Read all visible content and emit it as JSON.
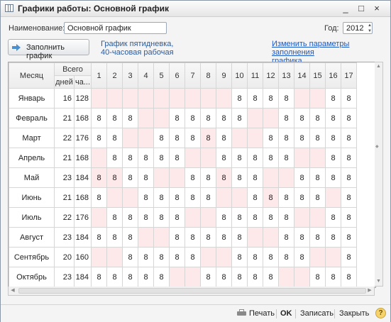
{
  "window": {
    "title": "Графики работы: Основной график",
    "buttons": [
      "_",
      "□",
      "×"
    ]
  },
  "form": {
    "name_label": "Наименование:",
    "name_value": "Основной график",
    "year_label": "Год:",
    "year_value": "2012",
    "fill_button": "Заполнить график",
    "info_line1": "График пятидневка,",
    "info_line2": "40-часовая рабочая",
    "link_line1": "Изменить параметры заполнения",
    "link_line2": "графика..."
  },
  "table": {
    "header_month": "Месяц",
    "header_total": "Всего",
    "header_days": "дней",
    "header_hours": "ча...",
    "day_columns": [
      "1",
      "2",
      "3",
      "4",
      "5",
      "6",
      "7",
      "8",
      "9",
      "10",
      "11",
      "12",
      "13",
      "14",
      "15",
      "16",
      "17"
    ],
    "rows": [
      {
        "month": "Январь",
        "days": "16",
        "hours": "128",
        "cells": [
          "",
          "",
          "",
          "",
          "",
          "",
          "",
          "",
          "",
          "8",
          "8",
          "8",
          "8",
          "",
          "",
          "8",
          "8"
        ],
        "we": [
          1,
          1,
          1,
          1,
          1,
          1,
          1,
          1,
          1,
          0,
          0,
          0,
          0,
          1,
          1,
          0,
          0
        ]
      },
      {
        "month": "Февраль",
        "days": "21",
        "hours": "168",
        "cells": [
          "8",
          "8",
          "8",
          "",
          "",
          "8",
          "8",
          "8",
          "8",
          "8",
          "",
          "",
          "8",
          "8",
          "8",
          "8",
          "8"
        ],
        "we": [
          0,
          0,
          0,
          1,
          1,
          0,
          0,
          0,
          0,
          0,
          1,
          1,
          0,
          0,
          0,
          0,
          0
        ]
      },
      {
        "month": "Март",
        "days": "22",
        "hours": "176",
        "cells": [
          "8",
          "8",
          "",
          "",
          "8",
          "8",
          "8",
          "8",
          "8",
          "",
          "",
          "8",
          "8",
          "8",
          "8",
          "8",
          "8"
        ],
        "we": [
          0,
          0,
          1,
          1,
          0,
          0,
          0,
          1,
          0,
          1,
          1,
          0,
          0,
          0,
          0,
          0,
          0
        ]
      },
      {
        "month": "Апрель",
        "days": "21",
        "hours": "168",
        "cells": [
          "",
          "8",
          "8",
          "8",
          "8",
          "8",
          "",
          "",
          "8",
          "8",
          "8",
          "8",
          "8",
          "",
          "",
          "8",
          "8"
        ],
        "we": [
          1,
          0,
          0,
          0,
          0,
          0,
          1,
          1,
          0,
          0,
          0,
          0,
          0,
          1,
          1,
          0,
          0
        ]
      },
      {
        "month": "Май",
        "days": "23",
        "hours": "184",
        "cells": [
          "8",
          "8",
          "8",
          "8",
          "",
          "",
          "8",
          "8",
          "8",
          "8",
          "8",
          "",
          "",
          "8",
          "8",
          "8",
          "8"
        ],
        "we": [
          1,
          1,
          0,
          0,
          1,
          1,
          0,
          0,
          1,
          0,
          0,
          1,
          1,
          0,
          0,
          0,
          0
        ]
      },
      {
        "month": "Июнь",
        "days": "21",
        "hours": "168",
        "cells": [
          "8",
          "",
          "",
          "8",
          "8",
          "8",
          "8",
          "8",
          "",
          "",
          "8",
          "8",
          "8",
          "8",
          "8",
          "",
          "8"
        ],
        "we": [
          0,
          1,
          1,
          0,
          0,
          0,
          0,
          0,
          1,
          1,
          0,
          1,
          0,
          0,
          0,
          1,
          0
        ]
      },
      {
        "month": "Июль",
        "days": "22",
        "hours": "176",
        "cells": [
          "",
          "8",
          "8",
          "8",
          "8",
          "8",
          "",
          "",
          "8",
          "8",
          "8",
          "8",
          "8",
          "",
          "",
          "8",
          "8"
        ],
        "we": [
          1,
          0,
          0,
          0,
          0,
          0,
          1,
          1,
          0,
          0,
          0,
          0,
          0,
          1,
          1,
          0,
          0
        ]
      },
      {
        "month": "Август",
        "days": "23",
        "hours": "184",
        "cells": [
          "8",
          "8",
          "8",
          "",
          "",
          "8",
          "8",
          "8",
          "8",
          "8",
          "",
          "",
          "8",
          "8",
          "8",
          "8",
          "8"
        ],
        "we": [
          0,
          0,
          0,
          1,
          1,
          0,
          0,
          0,
          0,
          0,
          1,
          1,
          0,
          0,
          0,
          0,
          0
        ]
      },
      {
        "month": "Сентябрь",
        "days": "20",
        "hours": "160",
        "cells": [
          "",
          "",
          "8",
          "8",
          "8",
          "8",
          "8",
          "",
          "",
          "8",
          "8",
          "8",
          "8",
          "8",
          "",
          "",
          "8"
        ],
        "we": [
          1,
          1,
          0,
          0,
          0,
          0,
          0,
          1,
          1,
          0,
          0,
          0,
          0,
          0,
          1,
          1,
          0
        ]
      },
      {
        "month": "Октябрь",
        "days": "23",
        "hours": "184",
        "cells": [
          "8",
          "8",
          "8",
          "8",
          "8",
          "",
          "",
          "8",
          "8",
          "8",
          "8",
          "8",
          "",
          "",
          "8",
          "8",
          "8"
        ],
        "we": [
          0,
          0,
          0,
          0,
          0,
          1,
          1,
          0,
          0,
          0,
          0,
          0,
          1,
          1,
          0,
          0,
          0
        ]
      }
    ]
  },
  "footer": {
    "print": "Печать",
    "ok": "OK",
    "save": "Записать",
    "close": "Закрыть",
    "help": "?"
  },
  "colors": {
    "weekend_cell": "#fde8ea",
    "link": "#1a58c8"
  }
}
